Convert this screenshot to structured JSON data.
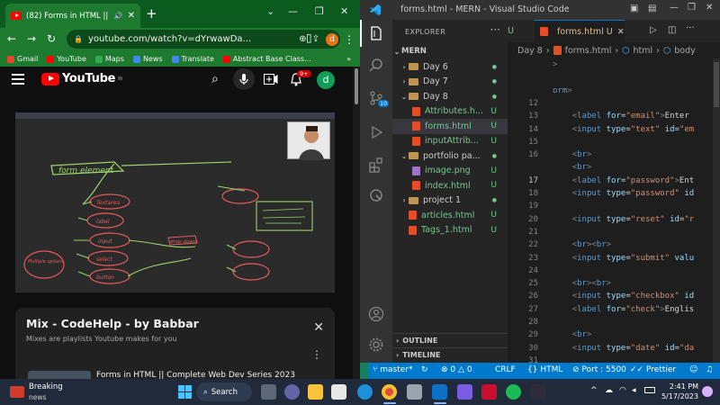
{
  "chrome": {
    "tab_title": "(82) Forms in HTML || Comp",
    "new_tab": "+",
    "url": "youtube.com/watch?v=dYrwawDa...",
    "profile_initial": "d",
    "bookmarks": [
      {
        "label": "Gmail",
        "color": "#ea4335"
      },
      {
        "label": "YouTube",
        "color": "#ff0000"
      },
      {
        "label": "Maps",
        "color": "#34a853"
      },
      {
        "label": "News",
        "color": "#4285f4"
      },
      {
        "label": "Translate",
        "color": "#4285f4"
      },
      {
        "label": "Abstract Base Class...",
        "color": "#ff0000"
      }
    ],
    "bookmarks_more": "»"
  },
  "youtube": {
    "logo_text": "YouTube",
    "logo_region": "IN",
    "notifications": "9+",
    "avatar": "d",
    "video_whiteboard": {
      "title_text": "form element",
      "labels": [
        "Textarea",
        "label",
        "input",
        "select",
        "button",
        "drop down",
        "Multiple options"
      ]
    },
    "mix": {
      "title": "Mix - CodeHelp - by Babbar",
      "subtitle": "Mixes are playlists Youtube makes for you",
      "next_item": "Forms in HTML || Complete Web Dev Series 2023"
    }
  },
  "vscode": {
    "title": "forms.html - MERN - Visual Studio Code",
    "explorer_label": "EXPLORER",
    "root_folder": "MERN",
    "source_control_badge": "10",
    "tree": [
      {
        "type": "folder",
        "label": "Day 6",
        "open": false,
        "status": "●",
        "depth": 1
      },
      {
        "type": "folder",
        "label": "Day 7",
        "open": false,
        "status": "●",
        "depth": 1
      },
      {
        "type": "folder",
        "label": "Day 8",
        "open": true,
        "status": "●",
        "depth": 1
      },
      {
        "type": "html",
        "label": "Attributes.h...",
        "status": "U",
        "depth": 2
      },
      {
        "type": "html",
        "label": "forms.html",
        "status": "U",
        "depth": 2,
        "selected": true
      },
      {
        "type": "html",
        "label": "inputAttrib...",
        "status": "U",
        "depth": 2
      },
      {
        "type": "folder",
        "label": "portfolio pa...",
        "open": true,
        "status": "●",
        "depth": 1
      },
      {
        "type": "png",
        "label": "image.png",
        "status": "U",
        "depth": 2
      },
      {
        "type": "html",
        "label": "index.html",
        "status": "U",
        "depth": 2
      },
      {
        "type": "folder",
        "label": "project 1",
        "open": false,
        "status": "●",
        "depth": 1
      },
      {
        "type": "html",
        "label": "articles.html",
        "status": "U",
        "depth": 1
      },
      {
        "type": "html",
        "label": "Tags_1.html",
        "status": "U",
        "depth": 1
      }
    ],
    "outline_label": "OUTLINE",
    "timeline_label": "TIMELINE",
    "prev_tab": "U",
    "active_tab": "forms.html U",
    "breadcrumbs": [
      "Day 8",
      "forms.html",
      "html",
      "body"
    ],
    "code_lines": [
      {
        "n": "",
        "html": "<span class='pu'>&gt;</span>"
      },
      {
        "n": "",
        "html": ""
      },
      {
        "n": "",
        "html": "<span class='tg'>orm</span><span class='pu'>&gt;</span>"
      },
      {
        "n": "12",
        "html": ""
      },
      {
        "n": "13",
        "html": "    <span class='pu'>&lt;</span><span class='tg'>label</span> <span class='at'>for</span>=<span class='st'>\"email\"</span><span class='pu'>&gt;</span>Enter"
      },
      {
        "n": "14",
        "html": "    <span class='pu'>&lt;</span><span class='tg'>input</span> <span class='at'>type</span>=<span class='st'>\"text\"</span> <span class='at'>id</span>=<span class='st'>\"em</span>"
      },
      {
        "n": "15",
        "html": ""
      },
      {
        "n": "16",
        "html": "    <span class='pu'>&lt;</span><span class='tg'>br</span><span class='pu'>&gt;</span>"
      },
      {
        "n": "",
        "html": "    <span class='pu'>&lt;</span><span class='tg'>br</span><span class='pu'>&gt;</span>"
      },
      {
        "n": "17",
        "html": "    <span class='pu'>&lt;</span><span class='tg'>label</span> <span class='at'>for</span>=<span class='st'>\"password\"</span><span class='pu'>&gt;</span>Ent"
      },
      {
        "n": "18",
        "html": "    <span class='pu'>&lt;</span><span class='tg'>input</span> <span class='at'>type</span>=<span class='st'>\"password\"</span> <span class='at'>id</span>"
      },
      {
        "n": "19",
        "html": ""
      },
      {
        "n": "20",
        "html": "    <span class='pu'>&lt;</span><span class='tg'>input</span> <span class='at'>type</span>=<span class='st'>\"reset\"</span> <span class='at'>id</span>=<span class='st'>\"r</span>"
      },
      {
        "n": "21",
        "html": ""
      },
      {
        "n": "22",
        "html": "    <span class='pu'>&lt;</span><span class='tg'>br</span><span class='pu'>&gt;&lt;</span><span class='tg'>br</span><span class='pu'>&gt;</span>"
      },
      {
        "n": "23",
        "html": "    <span class='pu'>&lt;</span><span class='tg'>input</span> <span class='at'>type</span>=<span class='st'>\"submit\"</span> <span class='at'>valu</span>"
      },
      {
        "n": "24",
        "html": ""
      },
      {
        "n": "25",
        "html": "    <span class='pu'>&lt;</span><span class='tg'>br</span><span class='pu'>&gt;&lt;</span><span class='tg'>br</span><span class='pu'>&gt;</span>"
      },
      {
        "n": "26",
        "html": "    <span class='pu'>&lt;</span><span class='tg'>input</span> <span class='at'>type</span>=<span class='st'>\"checkbox\"</span> <span class='at'>id</span>"
      },
      {
        "n": "27",
        "html": "    <span class='pu'>&lt;</span><span class='tg'>label</span> <span class='at'>for</span>=<span class='st'>\"check\"</span><span class='pu'>&gt;</span>Englis"
      },
      {
        "n": "28",
        "html": ""
      },
      {
        "n": "29",
        "html": "    <span class='pu'>&lt;</span><span class='tg'>br</span><span class='pu'>&gt;</span>"
      },
      {
        "n": "30",
        "html": "    <span class='pu'>&lt;</span><span class='tg'>input</span> <span class='at'>type</span>=<span class='st'>\"date\"</span> <span class='at'>id</span>=<span class='st'>\"da</span>"
      },
      {
        "n": "31",
        "html": ""
      }
    ],
    "current_line": "17",
    "status": {
      "branch": "master*",
      "errors": "0",
      "warnings": "0",
      "eol": "CRLF",
      "language": "HTML",
      "port": "Port : 5500",
      "prettier": "Prettier"
    }
  },
  "taskbar": {
    "news_title": "Breaking",
    "news_sub": "news",
    "search_label": "Search",
    "time": "2:41 PM",
    "date": "5/17/2023"
  }
}
